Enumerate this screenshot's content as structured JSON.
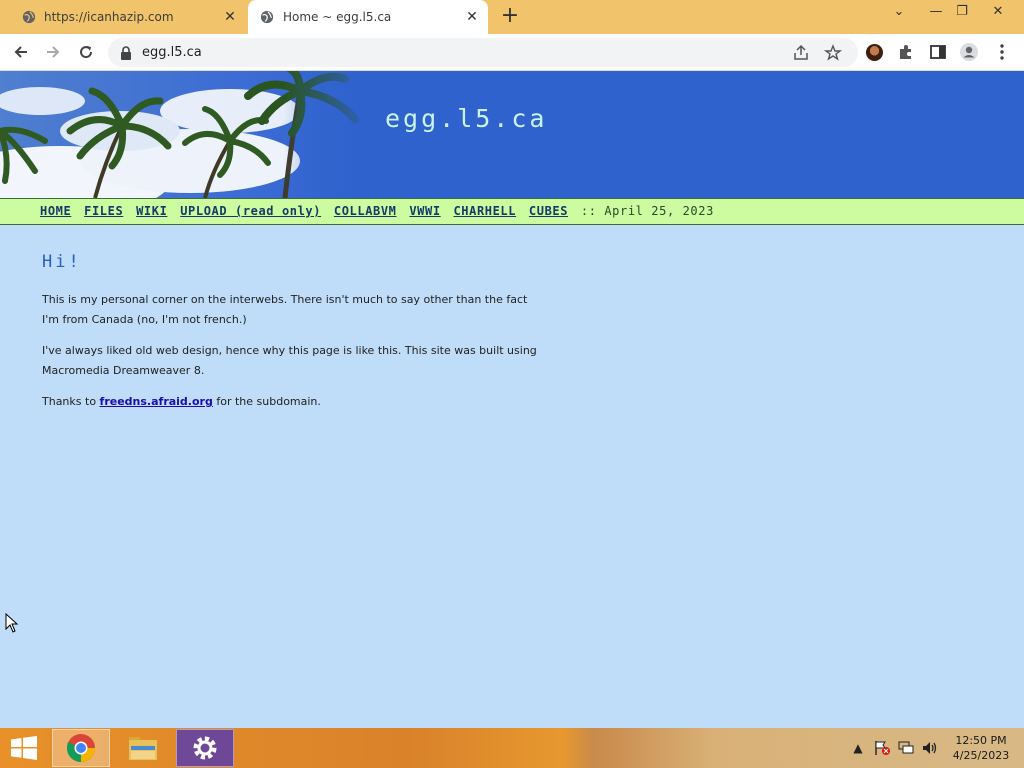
{
  "browser": {
    "tabs": [
      {
        "title": "https://icanhazip.com",
        "active": false
      },
      {
        "title": "Home ~ egg.l5.ca",
        "active": true
      }
    ],
    "address": "egg.l5.ca",
    "icons": [
      "back-icon",
      "forward-icon",
      "reload-icon",
      "lock-icon",
      "share-icon",
      "star-icon",
      "profile-picture",
      "extensions-icon",
      "side-panel-icon",
      "account-icon",
      "menu-icon"
    ]
  },
  "page": {
    "site_title": "egg.l5.ca",
    "nav": [
      "HOME",
      "FILES",
      "WIKI",
      "UPLOAD (read only)",
      "COLLABVM",
      "VWWI",
      "CHARHELL",
      "CUBES"
    ],
    "nav_separator": "::",
    "nav_date": "April 25, 2023",
    "heading": "Hi!",
    "para1": "This is my personal corner on the interwebs. There isn't much to say other than the fact I'm from Canada (no, I'm not french.)",
    "para2": "I've always liked old web design, hence why this page is like this. This site was built using Macromedia Dreamweaver 8.",
    "para3_before": "Thanks to ",
    "para3_link": "freedns.afraid.org",
    "para3_after": " for the subdomain.",
    "colors": {
      "header_bg": "#2f62cd",
      "nav_bg": "#ccfba0",
      "page_bg": "#bfdcf8",
      "title": "#c9f3ea"
    }
  },
  "taskbar": {
    "apps": [
      "Chrome",
      "File Explorer",
      "Settings"
    ],
    "clock_time": "12:50 PM",
    "clock_date": "4/25/2023"
  }
}
